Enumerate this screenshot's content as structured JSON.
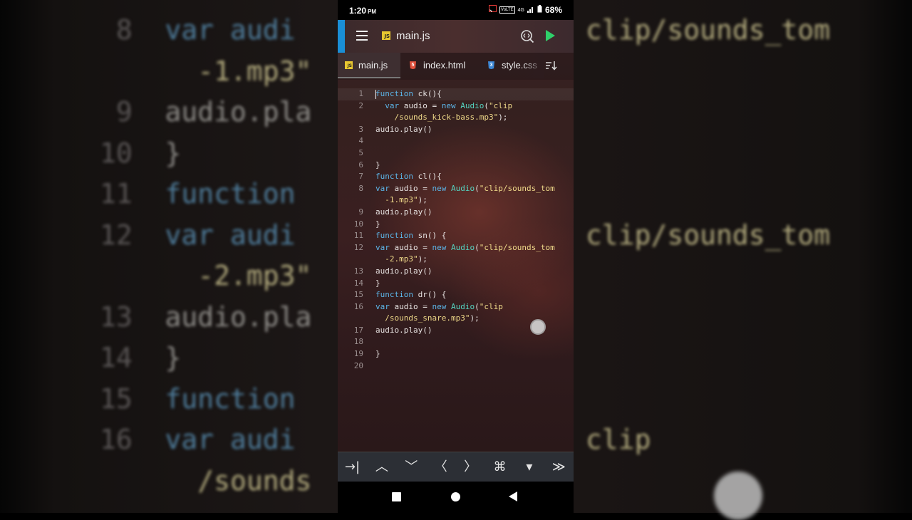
{
  "status_bar": {
    "time": "1:20",
    "time_suffix": "PM",
    "network": "VoLTE",
    "signal": "4G",
    "battery": "68%"
  },
  "toolbar": {
    "title": "main.js",
    "js_badge": "JS"
  },
  "tabs": [
    {
      "label": "main.js",
      "icon": "js-file-icon",
      "active": true
    },
    {
      "label": "index.html",
      "icon": "html5-icon",
      "active": false
    },
    {
      "label": "style.css",
      "icon": "css3-icon",
      "active": false
    }
  ],
  "code_lines": [
    {
      "n": "1",
      "text": "function ck(){"
    },
    {
      "n": "2",
      "text": "  var audio = new Audio(\"clip"
    },
    {
      "n": "",
      "text": "    /sounds_kick-bass.mp3\");"
    },
    {
      "n": "3",
      "text": "audio.play()"
    },
    {
      "n": "4",
      "text": ""
    },
    {
      "n": "5",
      "text": ""
    },
    {
      "n": "6",
      "text": "}"
    },
    {
      "n": "7",
      "text": "function cl(){"
    },
    {
      "n": "8",
      "text": "var audio = new Audio(\"clip/sounds_tom"
    },
    {
      "n": "",
      "text": "  -1.mp3\");"
    },
    {
      "n": "9",
      "text": "audio.play()"
    },
    {
      "n": "10",
      "text": "}"
    },
    {
      "n": "11",
      "text": "function sn() {"
    },
    {
      "n": "12",
      "text": "var audio = new Audio(\"clip/sounds_tom"
    },
    {
      "n": "",
      "text": "  -2.mp3\");"
    },
    {
      "n": "13",
      "text": "audio.play()"
    },
    {
      "n": "14",
      "text": "}"
    },
    {
      "n": "15",
      "text": "function dr() {"
    },
    {
      "n": "16",
      "text": "var audio = new Audio(\"clip"
    },
    {
      "n": "",
      "text": "  /sounds_snare.mp3\");"
    },
    {
      "n": "17",
      "text": "audio.play()"
    },
    {
      "n": "18",
      "text": ""
    },
    {
      "n": "19",
      "text": "}"
    },
    {
      "n": "20",
      "text": ""
    }
  ],
  "keybar": [
    {
      "name": "tab-key",
      "glyph": "→|"
    },
    {
      "name": "up-key",
      "glyph": "︿"
    },
    {
      "name": "down-key",
      "glyph": "﹀"
    },
    {
      "name": "left-key",
      "glyph": "〈"
    },
    {
      "name": "right-key",
      "glyph": "〉"
    },
    {
      "name": "command-key",
      "glyph": "⌘"
    },
    {
      "name": "dropdown-key",
      "glyph": "▾"
    },
    {
      "name": "more-key",
      "glyph": "≫"
    }
  ],
  "background_zoom": [
    {
      "n": "8",
      "code": "var audi",
      "tail": "clip/sounds_tom"
    },
    {
      "n": "",
      "code": "  -1.mp3\"",
      "tail": ""
    },
    {
      "n": "9",
      "code": "audio.pla",
      "tail": ""
    },
    {
      "n": "10",
      "code": "}",
      "tail": ""
    },
    {
      "n": "11",
      "code": "function",
      "tail": ""
    },
    {
      "n": "12",
      "code": "var audi",
      "tail": "clip/sounds_tom"
    },
    {
      "n": "",
      "code": "  -2.mp3\"",
      "tail": ""
    },
    {
      "n": "13",
      "code": "audio.pla",
      "tail": ""
    },
    {
      "n": "14",
      "code": "}",
      "tail": ""
    },
    {
      "n": "15",
      "code": "function",
      "tail": ""
    },
    {
      "n": "16",
      "code": "var audi",
      "tail": "clip"
    },
    {
      "n": "",
      "code": "  /sounds",
      "tail": ""
    }
  ]
}
